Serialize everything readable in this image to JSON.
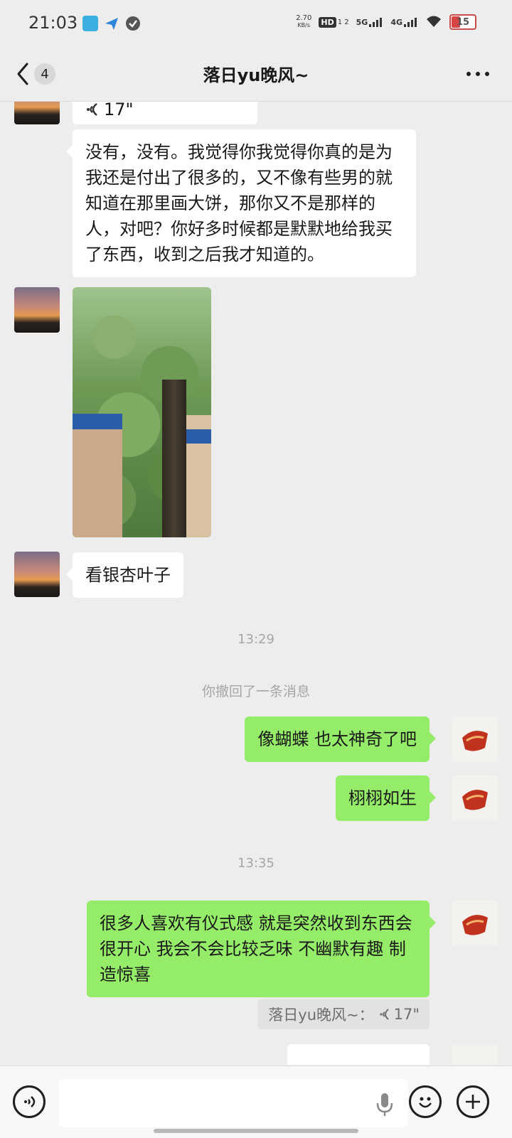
{
  "status": {
    "time": "21:03",
    "net_speed": "2.70",
    "net_unit": "KB/s",
    "hd_label": "HD",
    "hd_sub": "1 2",
    "sig1": "5G",
    "sig2": "4G",
    "battery": "15"
  },
  "header": {
    "unread_count": "4",
    "title": "落日yu晚风~"
  },
  "messages": {
    "partial_voice_duration": "17\"",
    "long_text": "没有，没有。我觉得你我觉得你真的是为我还是付出了很多的，又不像有些男的就知道在那里画大饼，那你又不是那样的人，对吧？你好多时候都是默默地给我买了东西，收到之后我才知道的。",
    "ginkgo_text": "看银杏叶子",
    "time1": "13:29",
    "recall_notice": "你撤回了一条消息",
    "butterfly_text": "像蝴蝶 也太神奇了吧",
    "lifelike_text": "栩栩如生",
    "time2": "13:35",
    "ritual_text": "很多人喜欢有仪式感 就是突然收到东西会很开心 我会不会比较乏味 不幽默有趣 制造惊喜",
    "quote_text": "落日yu晚风~：",
    "quote_voice": "17\""
  },
  "input": {
    "placeholder": ""
  },
  "colors": {
    "background": "#ededed",
    "bubble_sent": "#95ec69",
    "bubble_received": "#ffffff"
  },
  "icons": [
    "back-chevron-icon",
    "more-dots-icon",
    "voice-wave-icon",
    "microphone-icon",
    "emoji-icon",
    "plus-icon"
  ]
}
